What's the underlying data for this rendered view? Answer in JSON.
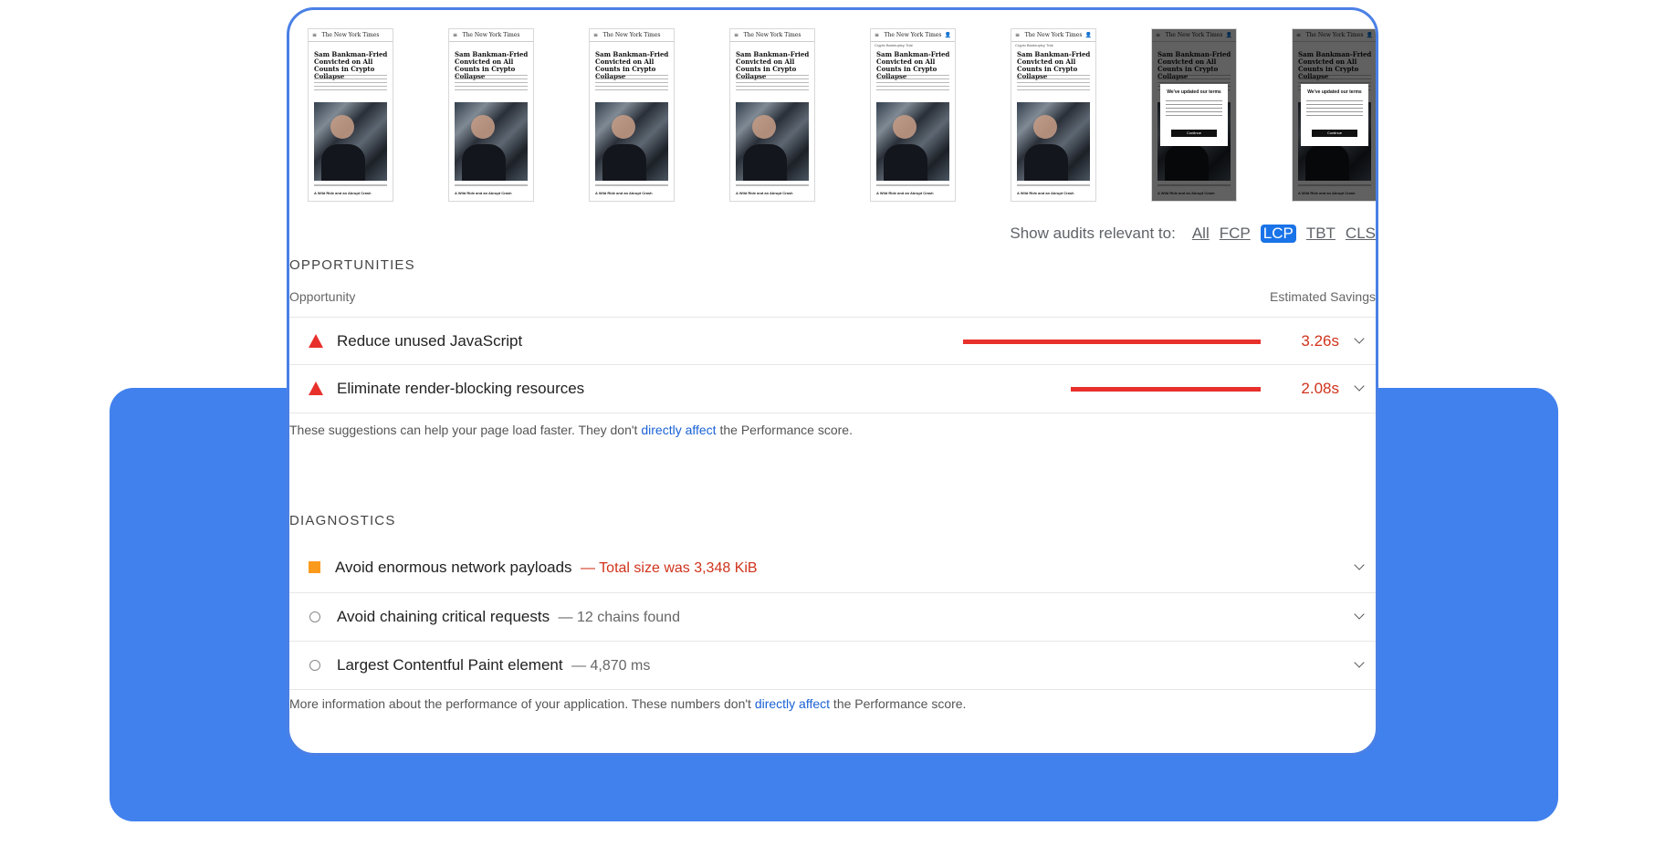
{
  "filmstrip": {
    "frames": [
      {
        "masthead": "The New York Times",
        "headline": "Sam Bankman-Fried Convicted on All Counts in Crypto Collapse",
        "footer": "A Wild Ride and an Abrupt Crash",
        "subhead": "",
        "modal": false
      },
      {
        "masthead": "The New York Times",
        "headline": "Sam Bankman-Fried Convicted on All Counts in Crypto Collapse",
        "footer": "A Wild Ride and an Abrupt Crash",
        "subhead": "",
        "modal": false
      },
      {
        "masthead": "The New York Times",
        "headline": "Sam Bankman-Fried Convicted on All Counts in Crypto Collapse",
        "footer": "A Wild Ride and an Abrupt Crash",
        "subhead": "",
        "modal": false
      },
      {
        "masthead": "The New York Times",
        "headline": "Sam Bankman-Fried Convicted on All Counts in Crypto Collapse",
        "footer": "A Wild Ride and an Abrupt Crash",
        "subhead": "",
        "modal": false
      },
      {
        "masthead": "The New York Times",
        "headline": "Sam Bankman-Fried Convicted on All Counts in Crypto Collapse",
        "footer": "A Wild Ride and an Abrupt Crash",
        "subhead": "Crypto Bankruptcy Trial",
        "modal": false
      },
      {
        "masthead": "The New York Times",
        "headline": "Sam Bankman-Fried Convicted on All Counts in Crypto Collapse",
        "footer": "A Wild Ride and an Abrupt Crash",
        "subhead": "Crypto Bankruptcy Trial",
        "modal": false
      },
      {
        "masthead": "The New York Times",
        "headline": "Sam Bankman-Fried Convicted on All Counts in Crypto Collapse",
        "footer": "A Wild Ride and an Abrupt Crash",
        "subhead": "",
        "modal": true,
        "modal_title": "We've updated our terms",
        "modal_button": "Continue"
      },
      {
        "masthead": "The New York Times",
        "headline": "Sam Bankman-Fried Convicted on All Counts in Crypto Collapse",
        "footer": "A Wild Ride and an Abrupt Crash",
        "subhead": "",
        "modal": true,
        "modal_title": "We've updated our terms",
        "modal_button": "Continue"
      }
    ]
  },
  "filter": {
    "label": "Show audits relevant to:",
    "options": [
      "All",
      "FCP",
      "LCP",
      "TBT",
      "CLS"
    ],
    "active": "LCP"
  },
  "opportunities": {
    "title": "OPPORTUNITIES",
    "col_left": "Opportunity",
    "col_right": "Estimated Savings",
    "items": [
      {
        "title": "Reduce unused JavaScript",
        "value": "3.26s",
        "savings_s": 3.26,
        "icon": "fail-triangle-icon"
      },
      {
        "title": "Eliminate render-blocking resources",
        "value": "2.08s",
        "savings_s": 2.08,
        "icon": "fail-triangle-icon"
      }
    ],
    "note_before": "These suggestions can help your page load faster. They don't ",
    "note_link": "directly affect",
    "note_after": " the Performance score."
  },
  "diagnostics": {
    "title": "DIAGNOSTICS",
    "items": [
      {
        "title": "Avoid enormous network payloads",
        "detail": "— Total size was 3,348 KiB",
        "icon": "average-square-icon",
        "severity": "warn"
      },
      {
        "title": "Avoid chaining critical requests",
        "detail": "— 12 chains found",
        "icon": "info-circle-icon",
        "severity": "info"
      },
      {
        "title": "Largest Contentful Paint element",
        "detail": "— 4,870 ms",
        "icon": "info-circle-icon",
        "severity": "info"
      }
    ],
    "note_before": "More information about the performance of your application. These numbers don't ",
    "note_link": "directly affect",
    "note_after": " the Performance score."
  },
  "colors": {
    "fail": "#e8302b",
    "average": "#fa9a1c",
    "link": "#1a62d6",
    "accent": "#1a73e8",
    "background_panel": "#4181ee"
  }
}
